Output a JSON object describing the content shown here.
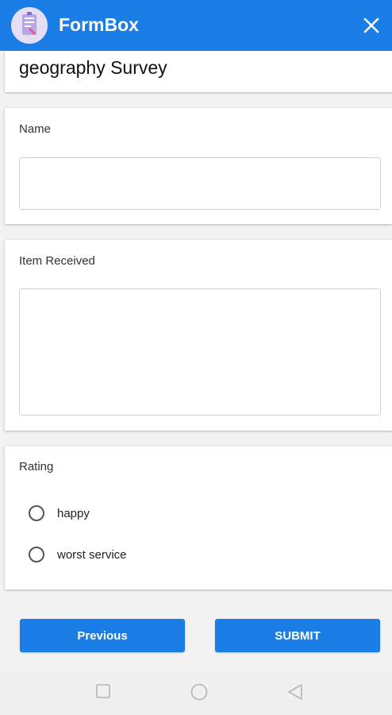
{
  "app_bar": {
    "title": "FormBox",
    "logo_icon": "clipboard-form-icon",
    "close_icon": "close-icon",
    "color": "#1a7ee6"
  },
  "survey": {
    "title": "geography Survey"
  },
  "fields": {
    "name": {
      "label": "Name",
      "value": ""
    },
    "item_received": {
      "label": "Item Received",
      "value": ""
    },
    "rating": {
      "label": "Rating",
      "options": [
        "happy",
        "worst service"
      ],
      "selected": null
    }
  },
  "buttons": {
    "previous_label": "Previous",
    "submit_label": "SUBMIT"
  },
  "nav": {
    "icons": [
      "recents-square-icon",
      "home-circle-icon",
      "back-triangle-icon"
    ]
  }
}
